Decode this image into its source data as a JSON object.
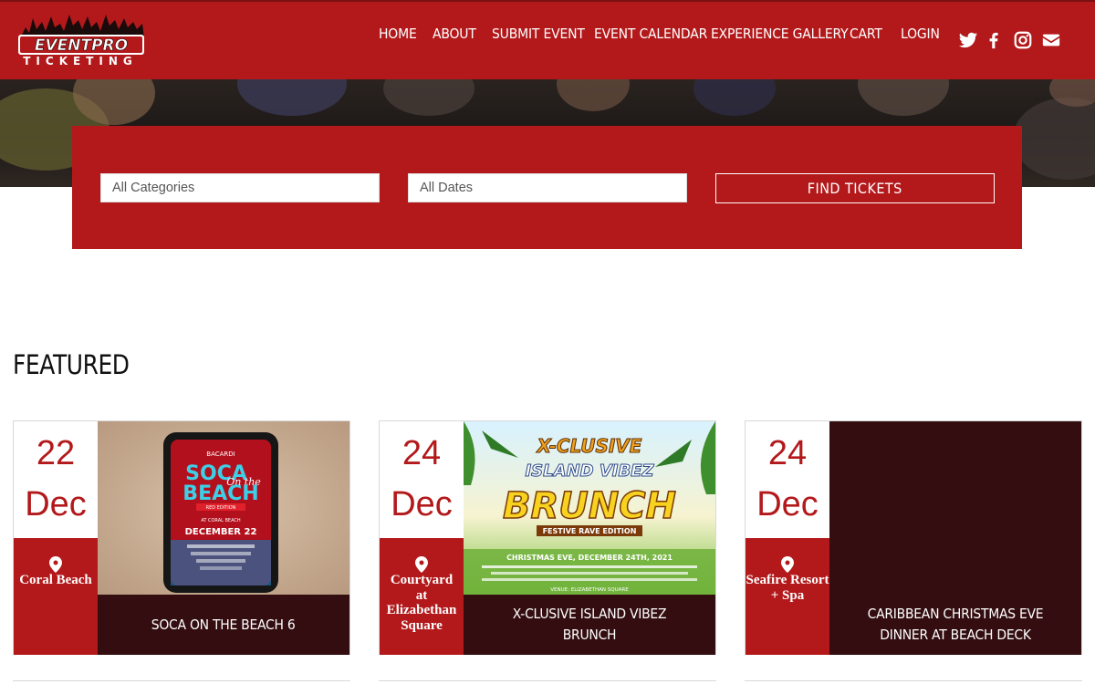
{
  "brand": {
    "name": "EVENTPRO",
    "tagline": "TICKETING",
    "primary_color": "#b3191b",
    "dark_color": "#330d10"
  },
  "nav": {
    "items": [
      {
        "label": "HOME"
      },
      {
        "label": "ABOUT"
      },
      {
        "label": "SUBMIT EVENT"
      },
      {
        "label": "EVENT CALENDAR"
      },
      {
        "label": "EXPERIENCE GALLERY"
      },
      {
        "label": "CART"
      },
      {
        "label": "LOGIN"
      }
    ],
    "social": [
      "twitter-icon",
      "facebook-icon",
      "instagram-icon",
      "envelope-icon"
    ]
  },
  "search": {
    "category_value": "All Categories",
    "date_value": "All Dates",
    "button_label": "FIND TICKETS"
  },
  "featured": {
    "heading": "FEATURED",
    "events": [
      {
        "day": "22",
        "month": "Dec",
        "location": "Coral Beach",
        "title": "SOCA ON THE BEACH 6",
        "poster": {
          "brand": "BACARDI",
          "line1": "SOCA",
          "line2": "BEACH",
          "script": "On the",
          "edition": "RED EDITION",
          "sub": "AT CORAL BEACH",
          "date": "DECEMBER 22"
        }
      },
      {
        "day": "24",
        "month": "Dec",
        "location": "Courtyard at Elizabethan Square",
        "title": "X-CLUSIVE ISLAND VIBEZ BRUNCH",
        "poster": {
          "line1": "X-CLUSIVE",
          "line2": "ISLAND VIBEZ",
          "line3": "BRUNCH",
          "band": "FESTIVE RAVE EDITION",
          "date": "CHRISTMAS EVE, DECEMBER 24TH, 2021",
          "venue": "VENUE: ELIZABETHAN SQUARE"
        }
      },
      {
        "day": "24",
        "month": "Dec",
        "location": "Seafire Resort + Spa",
        "title": "CARIBBEAN CHRISTMAS EVE DINNER AT BEACH DECK"
      }
    ]
  }
}
